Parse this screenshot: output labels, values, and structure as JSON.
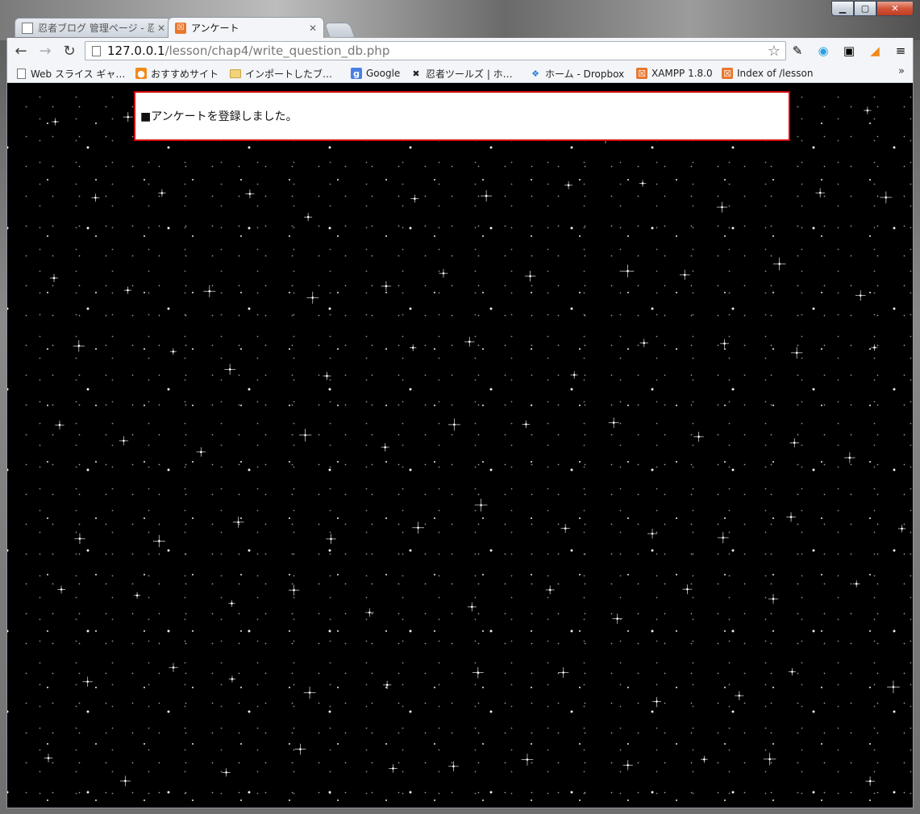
{
  "tabs": [
    {
      "title": "忍者ブログ 管理ページ - 忍者ブログ",
      "active": false
    },
    {
      "title": "アンケート",
      "active": true
    }
  ],
  "toolbar": {
    "url_host": "127.0.0.1",
    "url_path": "/lesson/chap4/write_question_db.php"
  },
  "bookmarks": [
    {
      "label": "Web スライス ギャ…",
      "icon": "page-icon"
    },
    {
      "label": "おすすめサイト",
      "icon": "bulb-icon"
    },
    {
      "label": "インポートしたブ…",
      "icon": "folder-icon"
    },
    {
      "label": "Google",
      "icon": "google-icon"
    },
    {
      "label": "忍者ツールズ | ホ…",
      "icon": "ninja-icon"
    },
    {
      "label": "ホーム - Dropbox",
      "icon": "dropbox-icon"
    },
    {
      "label": "XAMPP 1.8.0",
      "icon": "xampp-icon"
    },
    {
      "label": "Index of /lesson",
      "icon": "xampp-icon"
    }
  ],
  "page": {
    "message": "■アンケートを登録しました。"
  },
  "colors": {
    "message_border": "#d10000",
    "background": "#000000"
  }
}
